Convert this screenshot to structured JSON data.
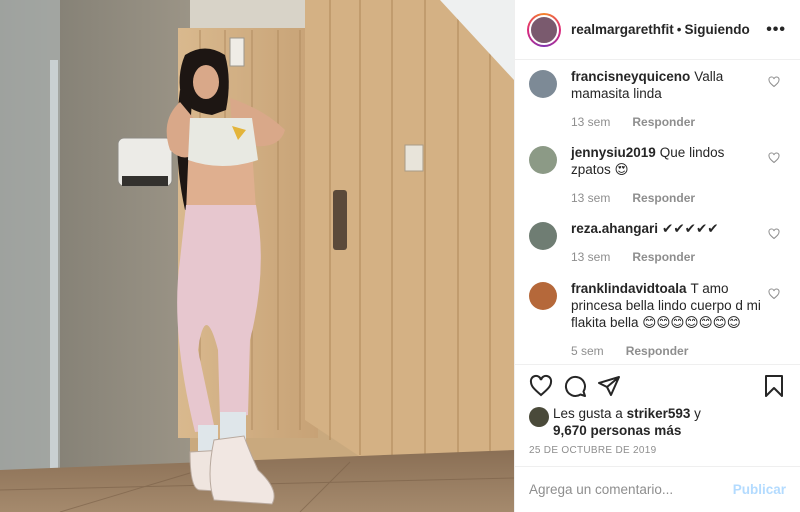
{
  "header": {
    "username": "realmargarethfit",
    "separator": "•",
    "follow_status": "Siguiendo",
    "more_label": "•••"
  },
  "comments": [
    {
      "user": "francisneyquiceno",
      "text": "Valla mamasita linda",
      "age": "13 sem",
      "reply": "Responder",
      "avatar_color": "#7d8a96"
    },
    {
      "user": "jennysiu2019",
      "text": "Que lindos zpatos 😍",
      "age": "13 sem",
      "reply": "Responder",
      "avatar_color": "#8c9a86"
    },
    {
      "user": "reza.ahangari",
      "text": "✔✔✔✔✔",
      "age": "13 sem",
      "reply": "Responder",
      "avatar_color": "#6f7d73"
    },
    {
      "user": "franklindavidtoala",
      "text": "T amo princesa bella lindo cuerpo d mi flakita bella 😊😊😊😊😊😊😊",
      "age": "5 sem",
      "reply": "Responder",
      "avatar_color": "#b5683a"
    }
  ],
  "likes": {
    "prefix": "Les gusta a",
    "user": "striker593",
    "connector": "y",
    "others": "9,670 personas más"
  },
  "date": "25 DE OCTUBRE DE 2019",
  "add_comment": {
    "placeholder": "Agrega un comentario...",
    "publish": "Publicar"
  },
  "icons": {
    "like": "heart-icon",
    "comment": "comment-icon",
    "share": "share-icon",
    "save": "bookmark-icon",
    "comment_like": "heart-icon"
  },
  "colors": {
    "text": "#262626",
    "muted": "#8e8e8e",
    "publish_disabled": "#b3dbff",
    "border": "#efefef"
  }
}
